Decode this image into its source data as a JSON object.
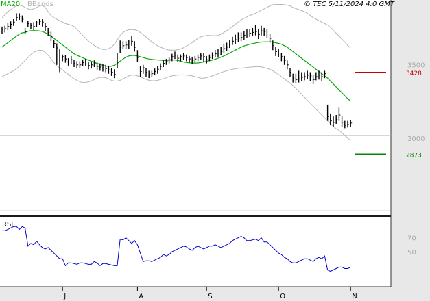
{
  "header": {
    "legend_ma": "MA20",
    "legend_bb": "BBands",
    "copyright": "© TEC 5/11/2024 4:0 GMT"
  },
  "colors": {
    "background": "#ffffff",
    "axis_panel": "#e8e8e8",
    "candle": "#000000",
    "ma": "#00aa00",
    "bbands": "#b4b4b4",
    "rsi": "#0000cc",
    "resistance": "#cc0000",
    "support": "#008800",
    "ref_line": "#bdbdbd",
    "axis_text": "#aaaaaa"
  },
  "chart_data": [
    {
      "type": "candlestick",
      "title": "",
      "ylim": [
        2490,
        3920
      ],
      "y_ticks": [
        3500,
        3000
      ],
      "reference_levels": [
        3500,
        3000
      ],
      "x_month_labels": [
        {
          "label": "J",
          "index": 21
        },
        {
          "label": "A",
          "index": 47
        },
        {
          "label": "S",
          "index": 71
        },
        {
          "label": "O",
          "index": 96
        },
        {
          "label": "N",
          "index": 121
        }
      ],
      "annotations": [
        {
          "name": "resistance",
          "value": 3428,
          "label": "3428",
          "color": "#cc0000"
        },
        {
          "name": "support",
          "value": 2873,
          "label": "2873",
          "color": "#008800"
        }
      ],
      "series": [
        {
          "name": "MA20",
          "kind": "line",
          "color": "#00aa00"
        },
        {
          "name": "BBands",
          "kind": "band",
          "color": "#b4b4b4"
        }
      ],
      "close": [
        3720,
        3725,
        3740,
        3755,
        3770,
        3800,
        3810,
        3790,
        3705,
        3760,
        3745,
        3740,
        3765,
        3775,
        3770,
        3740,
        3700,
        3670,
        3625,
        3595,
        3560,
        3535,
        3520,
        3500,
        3515,
        3490,
        3480,
        3480,
        3495,
        3500,
        3475,
        3480,
        3490,
        3470,
        3465,
        3460,
        3455,
        3445,
        3430,
        3415,
        3500,
        3600,
        3610,
        3615,
        3620,
        3640,
        3600,
        3530,
        3435,
        3460,
        3430,
        3415,
        3420,
        3435,
        3450,
        3470,
        3490,
        3505,
        3515,
        3535,
        3545,
        3525,
        3535,
        3540,
        3530,
        3520,
        3510,
        3520,
        3530,
        3540,
        3535,
        3515,
        3530,
        3545,
        3555,
        3560,
        3570,
        3590,
        3600,
        3620,
        3640,
        3650,
        3660,
        3665,
        3680,
        3690,
        3695,
        3700,
        3705,
        3685,
        3710,
        3705,
        3690,
        3660,
        3610,
        3570,
        3560,
        3535,
        3510,
        3480,
        3430,
        3390,
        3380,
        3385,
        3395,
        3400,
        3410,
        3405,
        3380,
        3400,
        3410,
        3400,
        3420,
        3130,
        3100,
        3090,
        3110,
        3140,
        3090,
        3070,
        3075,
        3085
      ],
      "high": [
        3740,
        3745,
        3765,
        3775,
        3790,
        3830,
        3830,
        3815,
        3730,
        3780,
        3765,
        3770,
        3780,
        3790,
        3790,
        3765,
        3730,
        3705,
        3650,
        3625,
        3585,
        3550,
        3545,
        3525,
        3540,
        3515,
        3505,
        3505,
        3515,
        3520,
        3500,
        3500,
        3510,
        3495,
        3490,
        3485,
        3480,
        3470,
        3460,
        3450,
        3560,
        3645,
        3640,
        3640,
        3650,
        3675,
        3640,
        3580,
        3470,
        3480,
        3460,
        3440,
        3440,
        3455,
        3470,
        3490,
        3510,
        3520,
        3530,
        3555,
        3570,
        3550,
        3550,
        3560,
        3550,
        3540,
        3535,
        3540,
        3550,
        3560,
        3560,
        3540,
        3550,
        3565,
        3580,
        3590,
        3600,
        3620,
        3630,
        3650,
        3670,
        3685,
        3700,
        3700,
        3710,
        3720,
        3725,
        3730,
        3750,
        3720,
        3745,
        3730,
        3720,
        3690,
        3645,
        3600,
        3590,
        3560,
        3540,
        3510,
        3460,
        3420,
        3420,
        3440,
        3430,
        3430,
        3440,
        3430,
        3410,
        3430,
        3440,
        3430,
        3440,
        3210,
        3150,
        3130,
        3140,
        3190,
        3130,
        3100,
        3100,
        3105
      ],
      "low": [
        3690,
        3700,
        3715,
        3725,
        3745,
        3780,
        3785,
        3770,
        3690,
        3735,
        3720,
        3715,
        3735,
        3750,
        3740,
        3710,
        3675,
        3640,
        3595,
        3480,
        3430,
        3505,
        3495,
        3475,
        3485,
        3465,
        3455,
        3460,
        3470,
        3475,
        3450,
        3455,
        3465,
        3445,
        3440,
        3435,
        3430,
        3420,
        3405,
        3390,
        3460,
        3560,
        3585,
        3590,
        3590,
        3610,
        3570,
        3500,
        3400,
        3420,
        3400,
        3390,
        3395,
        3410,
        3420,
        3445,
        3465,
        3480,
        3490,
        3505,
        3520,
        3500,
        3505,
        3515,
        3505,
        3495,
        3485,
        3495,
        3505,
        3515,
        3500,
        3490,
        3505,
        3520,
        3530,
        3535,
        3545,
        3560,
        3575,
        3595,
        3615,
        3620,
        3635,
        3640,
        3650,
        3665,
        3670,
        3675,
        3680,
        3655,
        3680,
        3675,
        3660,
        3630,
        3580,
        3540,
        3530,
        3505,
        3480,
        3450,
        3400,
        3360,
        3355,
        3360,
        3370,
        3375,
        3385,
        3370,
        3350,
        3375,
        3380,
        3370,
        3390,
        3100,
        3070,
        3060,
        3080,
        3100,
        3060,
        3050,
        3055,
        3060
      ],
      "ma20": [
        3600,
        3615,
        3630,
        3645,
        3660,
        3675,
        3688,
        3697,
        3700,
        3708,
        3712,
        3712,
        3712,
        3710,
        3706,
        3698,
        3688,
        3675,
        3660,
        3645,
        3630,
        3615,
        3600,
        3585,
        3570,
        3555,
        3545,
        3536,
        3528,
        3520,
        3512,
        3505,
        3498,
        3490,
        3483,
        3477,
        3472,
        3470,
        3470,
        3478,
        3490,
        3505,
        3520,
        3532,
        3540,
        3544,
        3544,
        3540,
        3535,
        3530,
        3524,
        3520,
        3517,
        3515,
        3513,
        3512,
        3510,
        3510,
        3512,
        3513,
        3513,
        3510,
        3505,
        3500,
        3496,
        3494,
        3493,
        3492,
        3493,
        3496,
        3500,
        3504,
        3508,
        3512,
        3518,
        3525,
        3532,
        3540,
        3550,
        3560,
        3570,
        3580,
        3590,
        3600,
        3608,
        3614,
        3620,
        3624,
        3628,
        3632,
        3634,
        3636,
        3636,
        3636,
        3634,
        3630,
        3625,
        3620,
        3610,
        3600,
        3585,
        3570,
        3555,
        3540,
        3525,
        3510,
        3495,
        3480,
        3465,
        3450,
        3435,
        3420,
        3405,
        3390,
        3370,
        3350,
        3330,
        3310,
        3290,
        3270,
        3250,
        3235
      ],
      "bb_upper": [
        3800,
        3820,
        3840,
        3855,
        3870,
        3880,
        3885,
        3880,
        3870,
        3860,
        3855,
        3860,
        3870,
        3880,
        3885,
        3870,
        3840,
        3815,
        3800,
        3790,
        3780,
        3770,
        3760,
        3755,
        3750,
        3740,
        3720,
        3700,
        3680,
        3660,
        3640,
        3625,
        3612,
        3600,
        3590,
        3585,
        3585,
        3590,
        3600,
        3620,
        3650,
        3680,
        3700,
        3712,
        3718,
        3720,
        3718,
        3712,
        3700,
        3685,
        3670,
        3652,
        3636,
        3622,
        3610,
        3600,
        3592,
        3585,
        3580,
        3580,
        3580,
        3582,
        3588,
        3596,
        3606,
        3618,
        3630,
        3645,
        3660,
        3670,
        3675,
        3680,
        3680,
        3678,
        3678,
        3680,
        3688,
        3700,
        3712,
        3725,
        3740,
        3755,
        3770,
        3785,
        3795,
        3805,
        3815,
        3822,
        3830,
        3840,
        3850,
        3860,
        3870,
        3880,
        3888,
        3890,
        3890,
        3890,
        3888,
        3885,
        3880,
        3870,
        3862,
        3855,
        3848,
        3840,
        3830,
        3815,
        3800,
        3790,
        3780,
        3770,
        3760,
        3750,
        3735,
        3715,
        3695,
        3675,
        3655,
        3635,
        3612,
        3595
      ],
      "bb_lower": [
        3400,
        3410,
        3420,
        3430,
        3440,
        3455,
        3470,
        3490,
        3510,
        3530,
        3550,
        3565,
        3575,
        3580,
        3578,
        3565,
        3545,
        3520,
        3495,
        3475,
        3460,
        3445,
        3430,
        3415,
        3400,
        3385,
        3375,
        3365,
        3360,
        3360,
        3365,
        3370,
        3380,
        3390,
        3395,
        3395,
        3392,
        3385,
        3375,
        3370,
        3370,
        3375,
        3385,
        3395,
        3405,
        3410,
        3410,
        3405,
        3398,
        3390,
        3382,
        3375,
        3372,
        3372,
        3375,
        3380,
        3385,
        3392,
        3400,
        3405,
        3408,
        3410,
        3412,
        3412,
        3410,
        3408,
        3405,
        3400,
        3395,
        3390,
        3390,
        3393,
        3398,
        3405,
        3412,
        3420,
        3428,
        3434,
        3440,
        3446,
        3450,
        3454,
        3456,
        3458,
        3460,
        3462,
        3464,
        3466,
        3468,
        3468,
        3466,
        3462,
        3456,
        3450,
        3440,
        3428,
        3415,
        3400,
        3385,
        3370,
        3355,
        3340,
        3320,
        3300,
        3280,
        3260,
        3240,
        3220,
        3200,
        3180,
        3160,
        3140,
        3120,
        3100,
        3080,
        3062,
        3047,
        3035,
        3020,
        3000,
        2985,
        2965
      ]
    },
    {
      "type": "line",
      "title": "RSI",
      "ylim": [
        0,
        100
      ],
      "y_ticks": [
        70,
        50
      ],
      "series": [
        {
          "name": "RSI",
          "color": "#0000cc",
          "values": [
            80,
            80,
            82,
            84,
            86,
            86,
            82,
            86,
            84,
            58,
            62,
            60,
            65,
            60,
            56,
            54,
            56,
            52,
            48,
            44,
            40,
            40,
            30,
            34,
            34,
            33,
            32,
            34,
            34,
            33,
            32,
            32,
            36,
            34,
            30,
            33,
            33,
            32,
            31,
            30,
            30,
            68,
            67,
            70,
            66,
            62,
            66,
            60,
            48,
            36,
            37,
            37,
            36,
            38,
            40,
            42,
            46,
            44,
            46,
            50,
            52,
            54,
            56,
            58,
            57,
            54,
            52,
            56,
            58,
            56,
            54,
            56,
            58,
            58,
            60,
            58,
            56,
            58,
            60,
            62,
            66,
            68,
            70,
            72,
            70,
            66,
            66,
            67,
            68,
            66,
            70,
            64,
            64,
            60,
            56,
            52,
            48,
            46,
            42,
            40,
            36,
            34,
            34,
            36,
            38,
            40,
            40,
            38,
            36,
            40,
            42,
            40,
            44,
            24,
            22,
            24,
            26,
            28,
            28,
            26,
            26,
            28
          ]
        }
      ]
    }
  ]
}
